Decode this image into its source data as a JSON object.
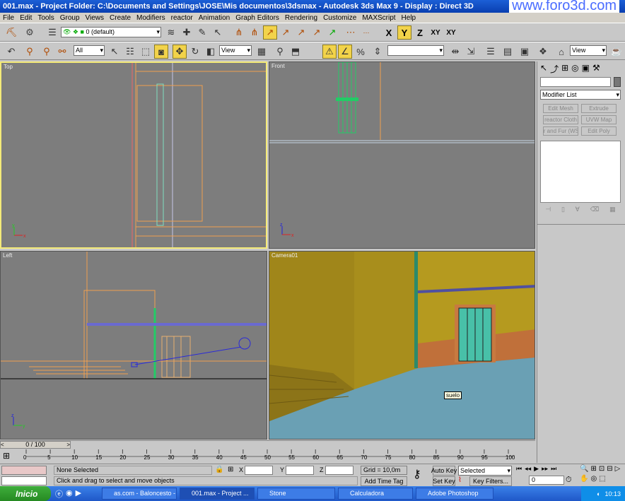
{
  "window": {
    "title": "001.max     - Project Folder: C:\\Documents and Settings\\JOSE\\Mis documentos\\3dsmax    - Autodesk 3ds Max 9        - Display : Direct 3D",
    "watermark": "www.foro3d.com"
  },
  "menu": [
    "File",
    "Edit",
    "Tools",
    "Group",
    "Views",
    "Create",
    "Modifiers",
    "reactor",
    "Animation",
    "Graph Editors",
    "Rendering",
    "Customize",
    "MAXScript",
    "Help"
  ],
  "toolbar": {
    "layer": "0 (default)",
    "axes": [
      "X",
      "Y",
      "Z",
      "XY",
      "XY"
    ],
    "selection_filter": "All",
    "ref_coord": "View",
    "ref_coord2": "View"
  },
  "viewports": {
    "top": "Top",
    "front": "Front",
    "left": "Left",
    "camera": "Camera01",
    "tooltip": "suelo"
  },
  "command_panel": {
    "modifier_list": "Modifier List",
    "buttons": [
      "Edit Mesh",
      "Extrude",
      "reactor Cloth",
      "UVW Map",
      "ir and Fur (WS",
      "Edit Poly"
    ]
  },
  "timeline": {
    "frame": "0 / 100",
    "ticks": [
      "0",
      "5",
      "10",
      "15",
      "20",
      "25",
      "30",
      "35",
      "40",
      "45",
      "50",
      "55",
      "60",
      "65",
      "70",
      "75",
      "80",
      "85",
      "90",
      "95",
      "100"
    ]
  },
  "status": {
    "selection": "None Selected",
    "prompt": "Click and drag to select and move objects",
    "x_label": "X",
    "y_label": "Y",
    "z_label": "Z",
    "grid": "Grid = 10,0m",
    "add_time_tag": "Add Time Tag",
    "auto_key": "Auto Key",
    "set_key": "Set Key",
    "selected": "Selected",
    "key_filters": "Key Filters...",
    "frame_value": "0"
  },
  "taskbar": {
    "start": "Inicio",
    "tasks": [
      "as.com - Baloncesto - ...",
      "001.max    - Project ...",
      "Stone",
      "Calculadora",
      "Adobe Photoshop"
    ],
    "clock": "10:13"
  }
}
